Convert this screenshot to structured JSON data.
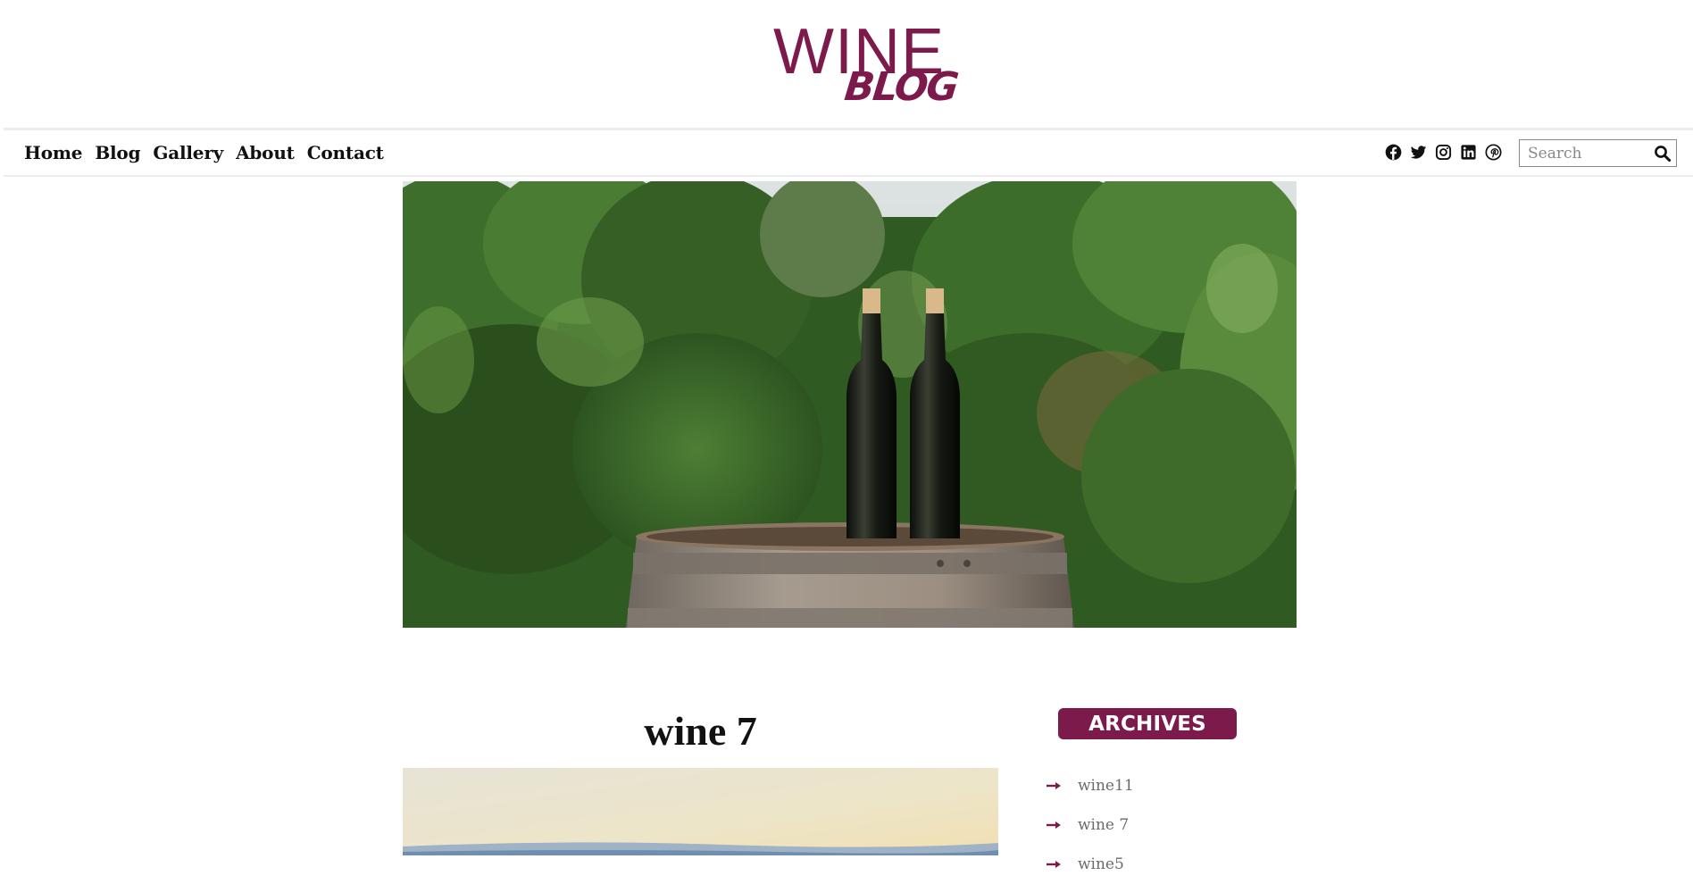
{
  "brand": {
    "logo_line1": "WINE",
    "logo_line2": "BLOG",
    "accent_color": "#7c1b4b"
  },
  "nav": {
    "items": [
      {
        "label": "Home"
      },
      {
        "label": "Blog"
      },
      {
        "label": "Gallery"
      },
      {
        "label": "About"
      },
      {
        "label": "Contact"
      }
    ]
  },
  "social_icons": [
    "facebook-icon",
    "twitter-icon",
    "instagram-icon",
    "linkedin-icon",
    "pinterest-icon"
  ],
  "search": {
    "placeholder": "Search",
    "value": "",
    "button_icon": "search-icon"
  },
  "hero_image": {
    "subject": "two wine bottles on a barrel in a vineyard"
  },
  "post": {
    "title": "wine 7"
  },
  "sidebar": {
    "archives_heading": "ARCHIVES",
    "archives": [
      {
        "label": "wine11"
      },
      {
        "label": "wine 7"
      },
      {
        "label": "wine5"
      }
    ]
  }
}
